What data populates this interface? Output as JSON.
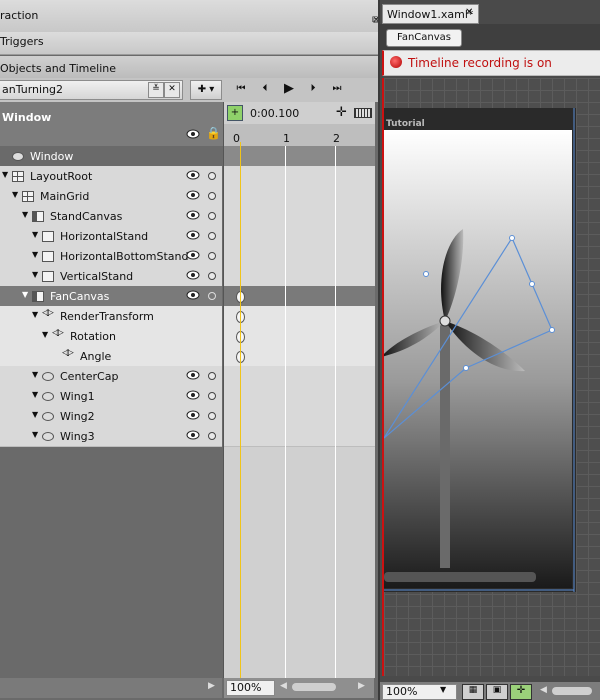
{
  "panel": {
    "title": "raction",
    "triggers_label": "Triggers",
    "objects_label": "Objects and Timeline",
    "storyboard_name": "anTurning2",
    "window_label": "Window",
    "time_display": "0:00.100",
    "ruler": [
      "0",
      "1",
      "2"
    ],
    "zoom_left": "100%"
  },
  "tree": [
    {
      "label": "Window",
      "icon": "window-icon",
      "indent": 0
    },
    {
      "label": "LayoutRoot",
      "icon": "grid-icon",
      "indent": 0
    },
    {
      "label": "MainGrid",
      "icon": "grid-icon",
      "indent": 1
    },
    {
      "label": "StandCanvas",
      "icon": "canvas-icon",
      "indent": 2
    },
    {
      "label": "HorizontalStand",
      "icon": "rectangle-icon",
      "indent": 3
    },
    {
      "label": "HorizontalBottomStand",
      "icon": "rectangle-icon",
      "indent": 3
    },
    {
      "label": "VerticalStand",
      "icon": "rectangle-icon",
      "indent": 3
    },
    {
      "label": "FanCanvas",
      "icon": "canvas-icon",
      "indent": 2
    },
    {
      "label": "RenderTransform",
      "icon": "transform-icon",
      "indent": 3
    },
    {
      "label": "Rotation",
      "icon": "transform-icon",
      "indent": 4
    },
    {
      "label": "Angle",
      "icon": "property-icon",
      "indent": 5
    },
    {
      "label": "CenterCap",
      "icon": "ellipse-icon",
      "indent": 3
    },
    {
      "label": "Wing1",
      "icon": "ellipse-icon",
      "indent": 3
    },
    {
      "label": "Wing2",
      "icon": "ellipse-icon",
      "indent": 3
    },
    {
      "label": "Wing3",
      "icon": "ellipse-icon",
      "indent": 3
    }
  ],
  "document": {
    "tab_label": "Window1.xaml*",
    "breadcrumb": "FanCanvas",
    "recording_text": "Timeline recording is on",
    "artboard_title": "Tutorial",
    "zoom": "100%"
  }
}
